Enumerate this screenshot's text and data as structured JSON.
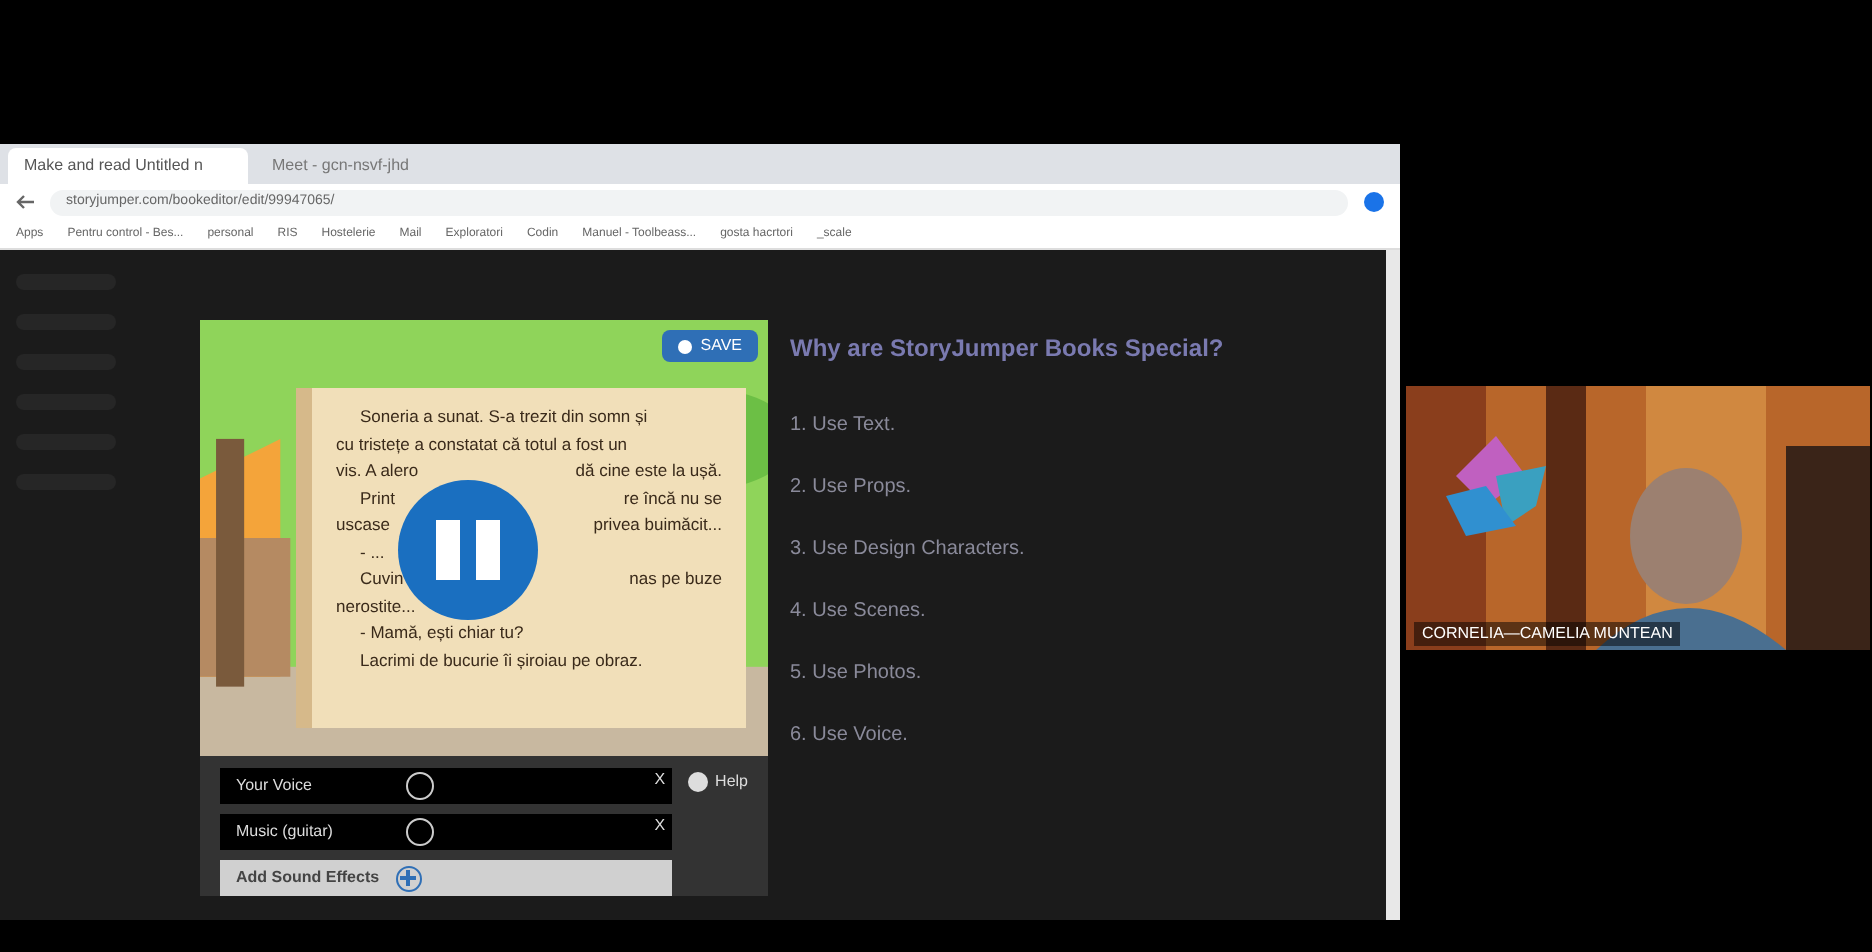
{
  "browser": {
    "tabs": [
      {
        "title": "Make and read Untitled n",
        "selected": true
      },
      {
        "title": "Meet - gcn-nsvf-jhd",
        "selected": false
      }
    ],
    "url": "storyjumper.com/bookeditor/edit/99947065/",
    "bookmarks": [
      "Apps",
      "Pentru control - Bes...",
      "personal",
      "RIS",
      "Hostelerie",
      "Mail",
      "Exploratori",
      "Codin",
      "Manuel - Toolbeass...",
      "gosta hacrtori",
      "_scale"
    ]
  },
  "editor": {
    "save_label": "SAVE",
    "story_lines": [
      {
        "left": "Soneria a sunat. S-a trezit din somn și",
        "indent": true
      },
      {
        "left": "cu tristețe a constatat că totul a fost un",
        "indent": false
      },
      {
        "left": "vis. A alero",
        "right": "dă cine este la ușă.",
        "indent": false
      },
      {
        "left": "Print",
        "right": "re încă nu se",
        "indent": true
      },
      {
        "left": "uscase",
        "right": "privea buimăcit...",
        "indent": false
      },
      {
        "left": "- ...",
        "indent": true
      },
      {
        "left": "Cuvin",
        "right": "nas pe buze",
        "indent": true
      },
      {
        "left": "nerostite...",
        "indent": false
      },
      {
        "left": "- Mamă, ești chiar tu?",
        "indent": true
      },
      {
        "left": "Lacrimi de bucurie îi șiroiau pe obraz.",
        "indent": true
      }
    ],
    "playing": true,
    "tracks": [
      {
        "label": "Your Voice",
        "close": "X"
      },
      {
        "label": "Music (guitar)",
        "close": "X"
      }
    ],
    "add_sound_label": "Add Sound Effects",
    "help_label": "Help"
  },
  "tips": {
    "heading": "Why are StoryJumper Books Special?",
    "items": [
      "1. Use Text.",
      "2. Use Props.",
      "3. Use Design Characters.",
      "4. Use Scenes.",
      "5. Use Photos.",
      "6. Use Voice."
    ]
  },
  "video_tile": {
    "name": "CORNELIA—CAMELIA MUNTEAN"
  }
}
